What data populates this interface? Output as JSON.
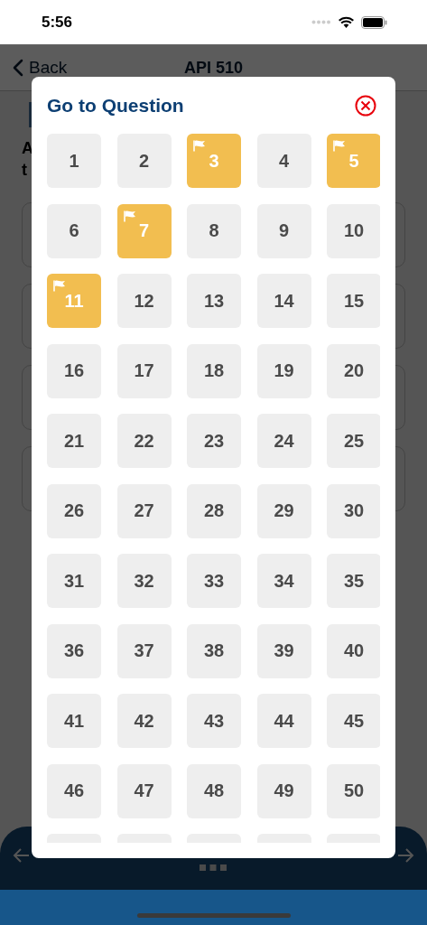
{
  "status_bar": {
    "time": "5:56"
  },
  "nav_bar": {
    "back": "Back",
    "title": "API 510"
  },
  "question_behind": {
    "lines": [
      "A",
      "t"
    ]
  },
  "dialog": {
    "title": "Go to Question",
    "questions": [
      {
        "label": "1",
        "flagged": false
      },
      {
        "label": "2",
        "flagged": false
      },
      {
        "label": "3",
        "flagged": true
      },
      {
        "label": "4",
        "flagged": false
      },
      {
        "label": "5",
        "flagged": true
      },
      {
        "label": "6",
        "flagged": false
      },
      {
        "label": "7",
        "flagged": true
      },
      {
        "label": "8",
        "flagged": false
      },
      {
        "label": "9",
        "flagged": false
      },
      {
        "label": "10",
        "flagged": false
      },
      {
        "label": "11",
        "flagged": true
      },
      {
        "label": "12",
        "flagged": false
      },
      {
        "label": "13",
        "flagged": false
      },
      {
        "label": "14",
        "flagged": false
      },
      {
        "label": "15",
        "flagged": false
      },
      {
        "label": "16",
        "flagged": false
      },
      {
        "label": "17",
        "flagged": false
      },
      {
        "label": "18",
        "flagged": false
      },
      {
        "label": "19",
        "flagged": false
      },
      {
        "label": "20",
        "flagged": false
      },
      {
        "label": "21",
        "flagged": false
      },
      {
        "label": "22",
        "flagged": false
      },
      {
        "label": "23",
        "flagged": false
      },
      {
        "label": "24",
        "flagged": false
      },
      {
        "label": "25",
        "flagged": false
      },
      {
        "label": "26",
        "flagged": false
      },
      {
        "label": "27",
        "flagged": false
      },
      {
        "label": "28",
        "flagged": false
      },
      {
        "label": "29",
        "flagged": false
      },
      {
        "label": "30",
        "flagged": false
      },
      {
        "label": "31",
        "flagged": false
      },
      {
        "label": "32",
        "flagged": false
      },
      {
        "label": "33",
        "flagged": false
      },
      {
        "label": "34",
        "flagged": false
      },
      {
        "label": "35",
        "flagged": false
      },
      {
        "label": "36",
        "flagged": false
      },
      {
        "label": "37",
        "flagged": false
      },
      {
        "label": "38",
        "flagged": false
      },
      {
        "label": "39",
        "flagged": false
      },
      {
        "label": "40",
        "flagged": false
      },
      {
        "label": "41",
        "flagged": false
      },
      {
        "label": "42",
        "flagged": false
      },
      {
        "label": "43",
        "flagged": false
      },
      {
        "label": "44",
        "flagged": false
      },
      {
        "label": "45",
        "flagged": false
      },
      {
        "label": "46",
        "flagged": false
      },
      {
        "label": "47",
        "flagged": false
      },
      {
        "label": "48",
        "flagged": false
      },
      {
        "label": "49",
        "flagged": false
      },
      {
        "label": "50",
        "flagged": false
      },
      {
        "flagged": false
      },
      {
        "flagged": false
      },
      {
        "flagged": false
      },
      {
        "flagged": false
      },
      {
        "flagged": false
      }
    ]
  }
}
